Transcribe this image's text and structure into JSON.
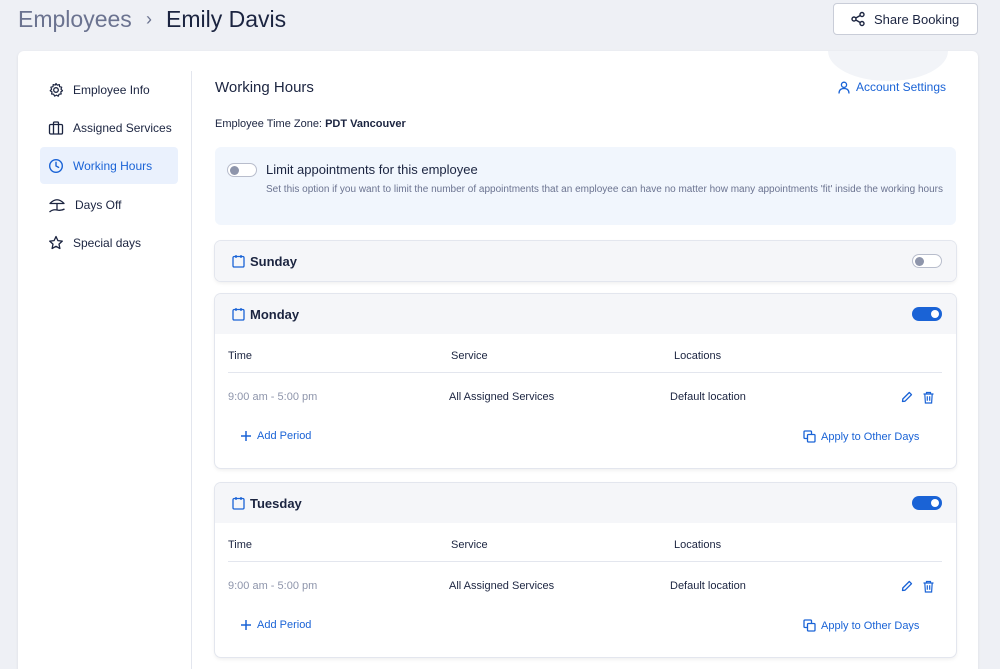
{
  "breadcrumb": {
    "root": "Employees",
    "separator": "›",
    "current": "Emily Davis"
  },
  "header": {
    "share_button": "Share Booking"
  },
  "sidebar": {
    "items": [
      {
        "label": "Employee Info",
        "icon": "gear-icon"
      },
      {
        "label": "Assigned Services",
        "icon": "briefcase-icon"
      },
      {
        "label": "Working Hours",
        "icon": "clock-icon",
        "active": true
      },
      {
        "label": "Days Off",
        "icon": "beach-umbrella-icon"
      },
      {
        "label": "Special days",
        "icon": "star-icon"
      }
    ]
  },
  "main": {
    "title": "Working Hours",
    "account_settings": "Account Settings",
    "timezone_label": "Employee Time Zone:",
    "timezone_value": "PDT Vancouver",
    "limit": {
      "enabled": false,
      "title": "Limit appointments for this employee",
      "description": "Set this option if you want to limit the number of appointments that an employee can have no matter how many appointments 'fit' inside the working hours"
    },
    "days": [
      {
        "name": "Sunday",
        "enabled": false
      },
      {
        "name": "Monday",
        "enabled": true,
        "columns": [
          "Time",
          "Service",
          "Locations"
        ],
        "periods": [
          {
            "time": "9:00 am - 5:00 pm",
            "service": "All Assigned Services",
            "location": "Default location"
          }
        ],
        "add_period": "Add Period",
        "apply_other": "Apply to Other Days"
      },
      {
        "name": "Tuesday",
        "enabled": true,
        "columns": [
          "Time",
          "Service",
          "Locations"
        ],
        "periods": [
          {
            "time": "9:00 am - 5:00 pm",
            "service": "All Assigned Services",
            "location": "Default location"
          }
        ],
        "add_period": "Add Period",
        "apply_other": "Apply to Other Days"
      }
    ]
  },
  "colors": {
    "accent": "#1a63d6",
    "active_bg": "#eaf1fd",
    "page_bg": "#eef0f5"
  }
}
